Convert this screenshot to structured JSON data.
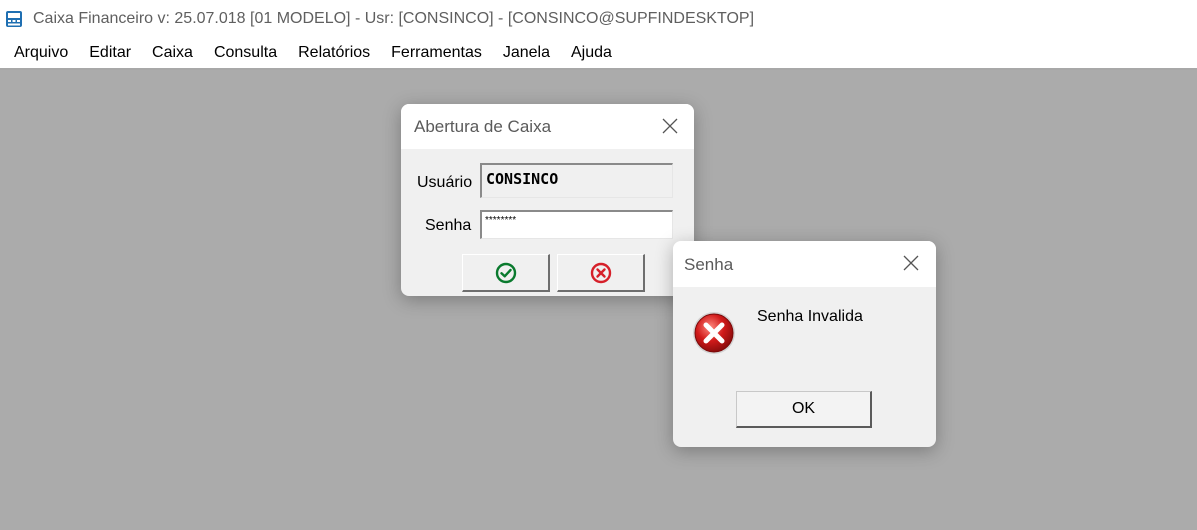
{
  "window": {
    "title": "Caixa Financeiro  v: 25.07.018   [01 MODELO] - Usr: [CONSINCO] - [CONSINCO@SUPFINDESKTOP]",
    "app_icon": "cash-register-icon"
  },
  "menu": {
    "items": [
      {
        "label": "Arquivo"
      },
      {
        "label": "Editar"
      },
      {
        "label": "Caixa"
      },
      {
        "label": "Consulta"
      },
      {
        "label": "Relatórios"
      },
      {
        "label": "Ferramentas"
      },
      {
        "label": "Janela"
      },
      {
        "label": "Ajuda"
      }
    ]
  },
  "login_dialog": {
    "title": "Abertura de Caixa",
    "user_label": "Usuário",
    "user_value": "CONSINCO",
    "password_label": "Senha",
    "password_value": "********",
    "confirm_icon": "check-circle-icon",
    "cancel_icon": "x-circle-icon",
    "confirm_color": "#0a7a2e",
    "cancel_color": "#d6202a"
  },
  "error_dialog": {
    "title": "Senha",
    "message": "Senha Invalida",
    "ok_label": "OK",
    "icon": "error-icon",
    "icon_color": "#d11a1a"
  }
}
